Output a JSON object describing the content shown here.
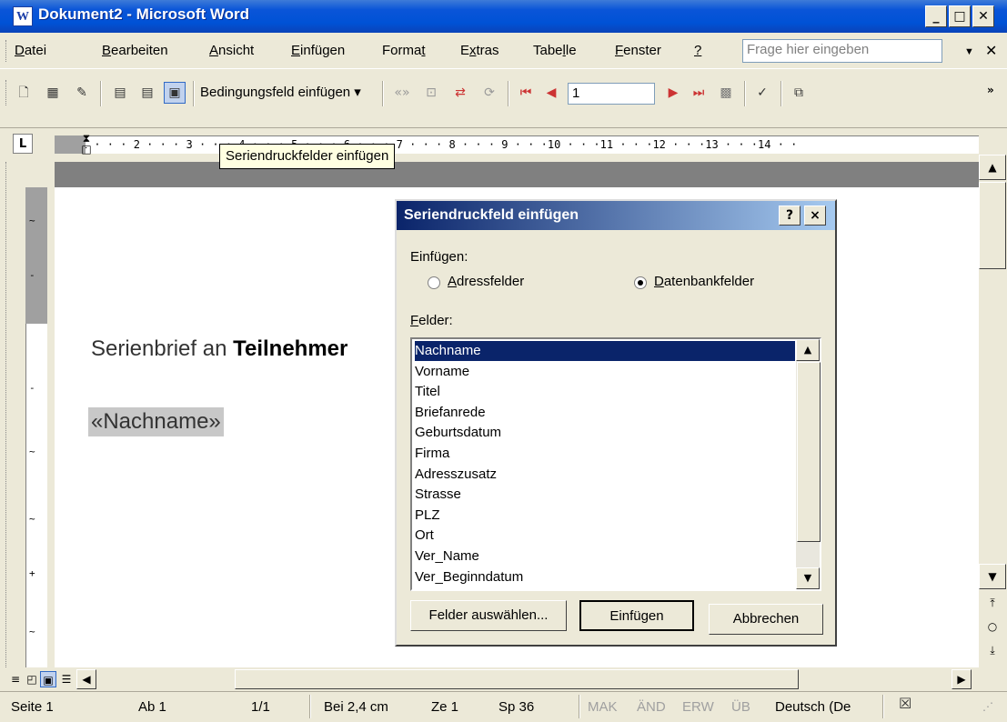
{
  "window": {
    "title": "Dokument2 - Microsoft Word",
    "icon": "word-icon"
  },
  "menubar": {
    "items": [
      {
        "pre": "",
        "u": "D",
        "post": "atei"
      },
      {
        "pre": "",
        "u": "B",
        "post": "earbeiten"
      },
      {
        "pre": "",
        "u": "A",
        "post": "nsicht"
      },
      {
        "pre": "",
        "u": "E",
        "post": "infügen"
      },
      {
        "pre": "Forma",
        "u": "t",
        "post": ""
      },
      {
        "pre": "E",
        "u": "x",
        "post": "tras"
      },
      {
        "pre": "Tabe",
        "u": "l",
        "post": "le"
      },
      {
        "pre": "",
        "u": "F",
        "post": "enster"
      },
      {
        "pre": "",
        "u": "?",
        "post": ""
      }
    ],
    "help_placeholder": "Frage hier eingeben"
  },
  "toolbar": {
    "condition_field_label": "Bedingungsfeld einfügen ▾",
    "record_number": "1"
  },
  "tooltip": "Seriendruckfelder einfügen",
  "ruler": {
    "text": "· · 1 · · · 2 · · · 3 · · · 4 · · · 5 · · · 6 · · · 7 · · · 8 · · · 9 · · ·10 · · ·11 · · ·12 · · ·13 · · ·14 · ·"
  },
  "document": {
    "line1_plain": "Serienbrief an ",
    "line1_bold": "Teilnehmer",
    "field": "«Nachname»"
  },
  "dialog": {
    "title": "Seriendruckfeld einfügen",
    "help_btn": "?",
    "close_btn": "×",
    "insert_label": "Einfügen:",
    "radio_address": "Adressfelder",
    "radio_database": "Datenbankfelder",
    "selected_radio": "database",
    "fields_label": "Felder:",
    "fields": [
      "Nachname",
      "Vorname",
      "Titel",
      "Briefanrede",
      "Geburtsdatum",
      "Firma",
      "Adresszusatz",
      "Strasse",
      "PLZ",
      "Ort",
      "Ver_Name",
      "Ver_Beginndatum"
    ],
    "selected_field": "Nachname",
    "btn_select_fields": "Felder auswählen...",
    "btn_insert": "Einfügen",
    "btn_cancel": "Abbrechen"
  },
  "statusbar": {
    "page": "Seite 1",
    "section": "Ab 1",
    "pages": "1/1",
    "position": "Bei 2,4 cm",
    "line": "Ze 1",
    "column": "Sp 36",
    "mak": "MAK",
    "and": "ÄND",
    "erw": "ERW",
    "ub": "ÜB",
    "language": "Deutsch (De"
  },
  "colors": {
    "titlebar": "#0a55d8",
    "dialog_title": "#0a246a",
    "selection": "#0a246a",
    "tooltip_bg": "#ffffe1"
  }
}
